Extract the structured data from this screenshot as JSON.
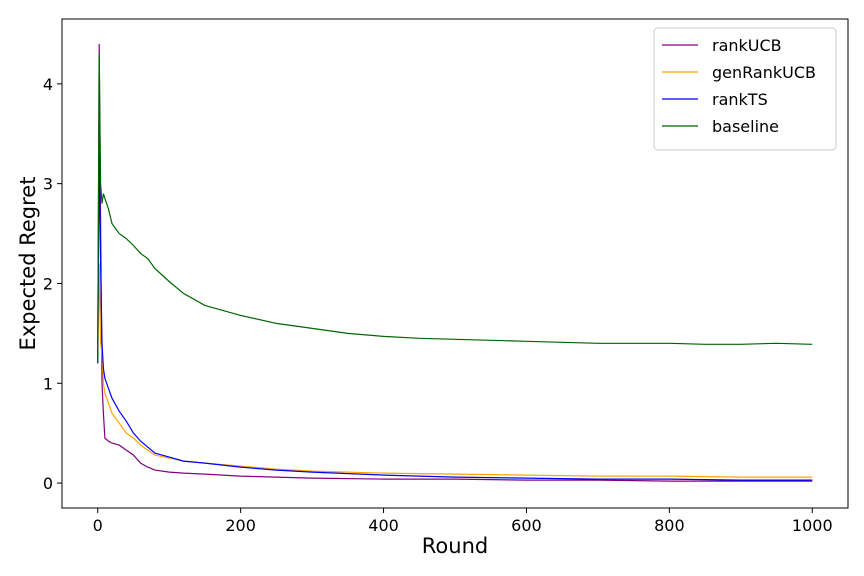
{
  "chart_data": {
    "type": "line",
    "xlabel": "Round",
    "ylabel": "Expected Regret",
    "xlim": [
      -50,
      1050
    ],
    "ylim": [
      -0.25,
      4.65
    ],
    "xticks": [
      0,
      200,
      400,
      600,
      800,
      1000
    ],
    "yticks": [
      0,
      1,
      2,
      3,
      4
    ],
    "grid": false,
    "legend_position": "top-right",
    "series": [
      {
        "name": "rankUCB",
        "color": "#800080",
        "x": [
          0,
          2,
          4,
          6,
          8,
          10,
          15,
          20,
          30,
          40,
          50,
          60,
          70,
          80,
          100,
          120,
          150,
          200,
          250,
          300,
          400,
          500,
          600,
          700,
          800,
          900,
          1000
        ],
        "values": [
          1.2,
          4.4,
          2.6,
          1.0,
          0.7,
          0.45,
          0.42,
          0.4,
          0.38,
          0.33,
          0.28,
          0.2,
          0.16,
          0.13,
          0.11,
          0.1,
          0.09,
          0.07,
          0.06,
          0.05,
          0.04,
          0.04,
          0.03,
          0.03,
          0.02,
          0.02,
          0.02
        ]
      },
      {
        "name": "genRankUCB",
        "color": "#ffa500",
        "x": [
          0,
          2,
          4,
          6,
          8,
          10,
          15,
          20,
          30,
          40,
          50,
          60,
          70,
          80,
          100,
          120,
          150,
          200,
          250,
          300,
          400,
          500,
          600,
          700,
          800,
          900,
          1000
        ],
        "values": [
          1.2,
          2.2,
          1.4,
          1.3,
          1.0,
          0.9,
          0.8,
          0.7,
          0.6,
          0.5,
          0.45,
          0.38,
          0.33,
          0.28,
          0.25,
          0.22,
          0.2,
          0.17,
          0.14,
          0.12,
          0.1,
          0.09,
          0.08,
          0.07,
          0.07,
          0.06,
          0.06
        ]
      },
      {
        "name": "rankTS",
        "color": "#0000ff",
        "x": [
          0,
          2,
          4,
          6,
          8,
          10,
          15,
          20,
          30,
          40,
          50,
          60,
          70,
          80,
          100,
          120,
          150,
          200,
          250,
          300,
          400,
          500,
          600,
          700,
          800,
          900,
          1000
        ],
        "values": [
          1.2,
          3.3,
          2.2,
          1.4,
          1.15,
          1.05,
          0.95,
          0.85,
          0.72,
          0.62,
          0.5,
          0.42,
          0.36,
          0.3,
          0.26,
          0.22,
          0.2,
          0.16,
          0.13,
          0.11,
          0.08,
          0.06,
          0.05,
          0.04,
          0.04,
          0.03,
          0.03
        ]
      },
      {
        "name": "baseline",
        "color": "#006400",
        "x": [
          0,
          2,
          4,
          6,
          8,
          10,
          15,
          20,
          30,
          40,
          50,
          60,
          70,
          80,
          100,
          120,
          150,
          200,
          250,
          300,
          350,
          400,
          450,
          500,
          550,
          600,
          650,
          700,
          750,
          800,
          850,
          900,
          950,
          1000
        ],
        "values": [
          1.2,
          4.3,
          3.0,
          2.8,
          2.9,
          2.85,
          2.75,
          2.6,
          2.5,
          2.45,
          2.38,
          2.3,
          2.25,
          2.15,
          2.02,
          1.9,
          1.78,
          1.68,
          1.6,
          1.55,
          1.5,
          1.47,
          1.45,
          1.44,
          1.43,
          1.42,
          1.41,
          1.4,
          1.4,
          1.4,
          1.39,
          1.39,
          1.4,
          1.39
        ]
      }
    ]
  }
}
